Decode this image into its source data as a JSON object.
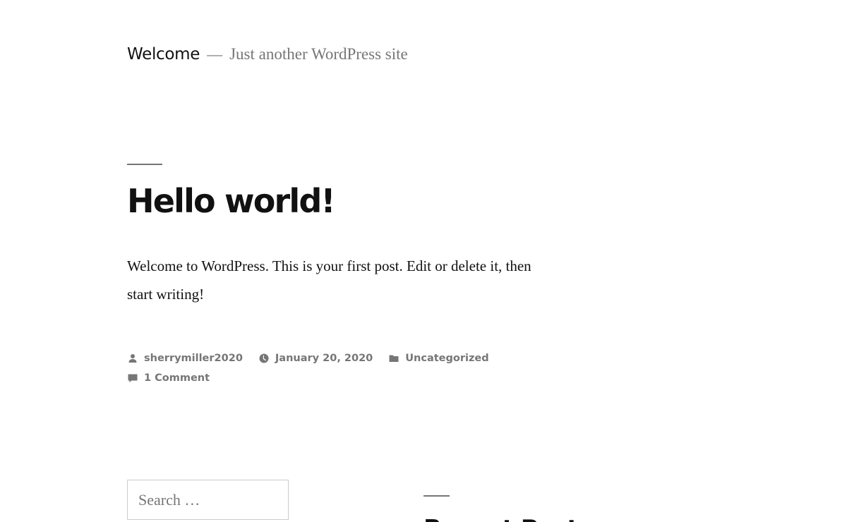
{
  "header": {
    "site_title": "Welcome",
    "separator": "—",
    "site_description": "Just another WordPress site"
  },
  "post": {
    "title": "Hello world!",
    "content": "Welcome to WordPress. This is your first post. Edit or delete it, then start writing!",
    "meta": {
      "author": "sherrymiller2020",
      "date": "January 20, 2020",
      "category": "Uncategorized",
      "comments": "1 Comment"
    }
  },
  "sidebar": {
    "search_placeholder": "Search …",
    "recent_posts_title": "Recent Posts"
  },
  "colors": {
    "text": "#111111",
    "muted": "#767676",
    "border": "#cccccc",
    "background": "#ffffff"
  },
  "icons": {
    "author": "person-icon",
    "date": "clock-icon",
    "category": "folder-icon",
    "comments": "comment-icon"
  }
}
